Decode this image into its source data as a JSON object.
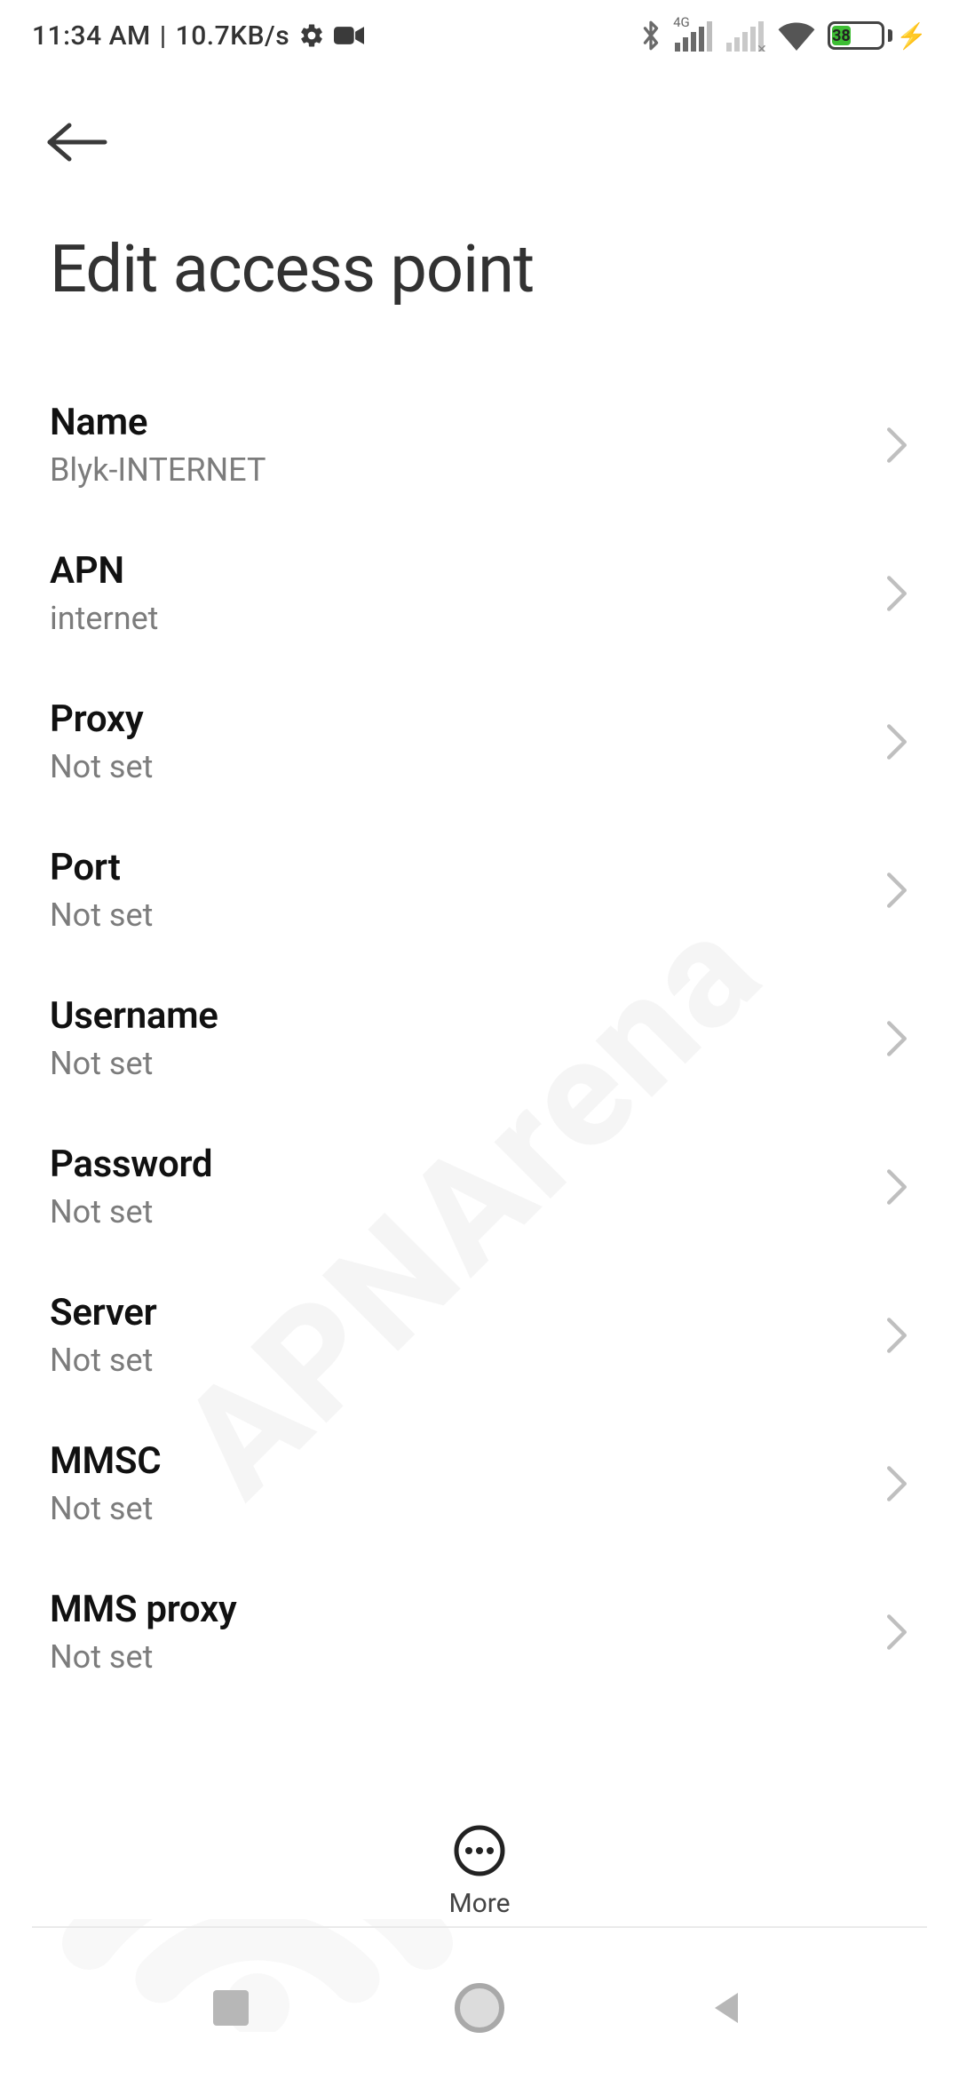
{
  "status": {
    "time": "11:34 AM",
    "speed": "10.7KB/s",
    "battery_percent": "38",
    "network_label_4g": "4G"
  },
  "header": {
    "title": "Edit access point"
  },
  "settings": {
    "items": [
      {
        "label": "Name",
        "value": "Blyk-INTERNET"
      },
      {
        "label": "APN",
        "value": "internet"
      },
      {
        "label": "Proxy",
        "value": "Not set"
      },
      {
        "label": "Port",
        "value": "Not set"
      },
      {
        "label": "Username",
        "value": "Not set"
      },
      {
        "label": "Password",
        "value": "Not set"
      },
      {
        "label": "Server",
        "value": "Not set"
      },
      {
        "label": "MMSC",
        "value": "Not set"
      },
      {
        "label": "MMS proxy",
        "value": "Not set"
      }
    ]
  },
  "more": {
    "label": "More"
  },
  "watermark": {
    "text": "APNArena"
  }
}
